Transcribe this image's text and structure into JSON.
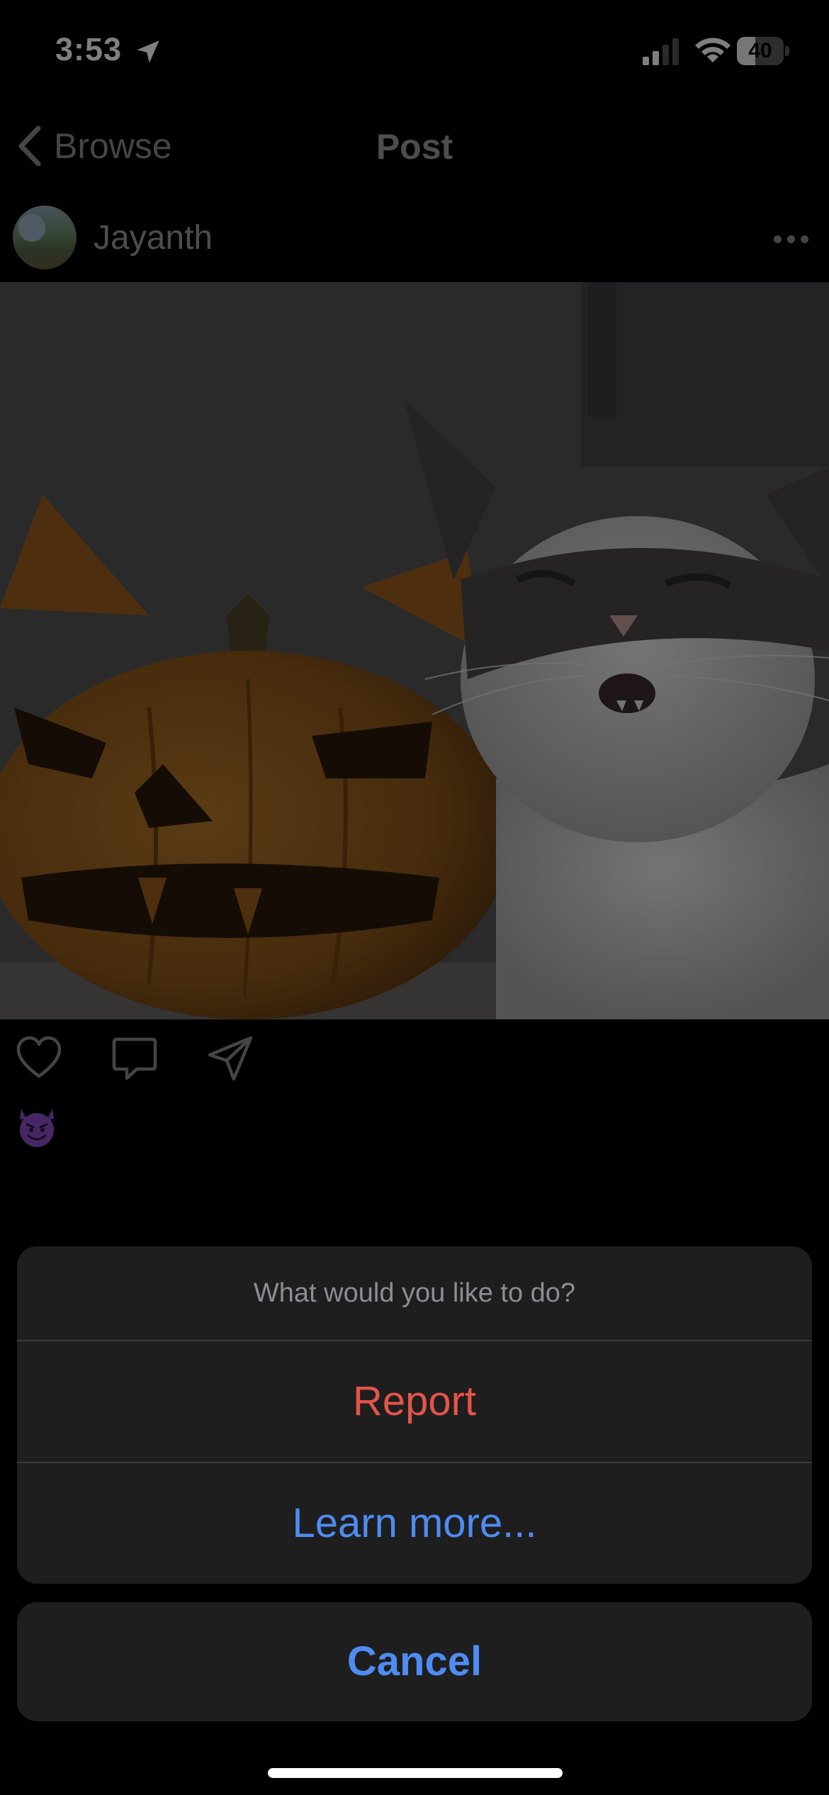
{
  "status_bar": {
    "time": "3:53",
    "battery_level": "40",
    "battery_fraction": 0.4,
    "signal_bars_active": 2,
    "icons": [
      "location-arrow-icon",
      "cellular-signal-icon",
      "wifi-icon",
      "battery-icon"
    ]
  },
  "nav": {
    "back_label": "Browse",
    "title": "Post"
  },
  "post": {
    "username": "Jayanth",
    "caption_emoji": "😈",
    "actions": [
      "heart-icon",
      "comment-icon",
      "share-icon"
    ]
  },
  "action_sheet": {
    "title": "What would you like to do?",
    "options": [
      {
        "label": "Report",
        "color": "#e5544a"
      },
      {
        "label": "Learn more...",
        "color": "#4e8cf1"
      }
    ],
    "cancel_label": "Cancel"
  },
  "colors": {
    "background": "#000000",
    "sheet_background": "#1e1e1f",
    "accent_blue": "#4e8cf1",
    "destructive_red": "#e5544a"
  }
}
